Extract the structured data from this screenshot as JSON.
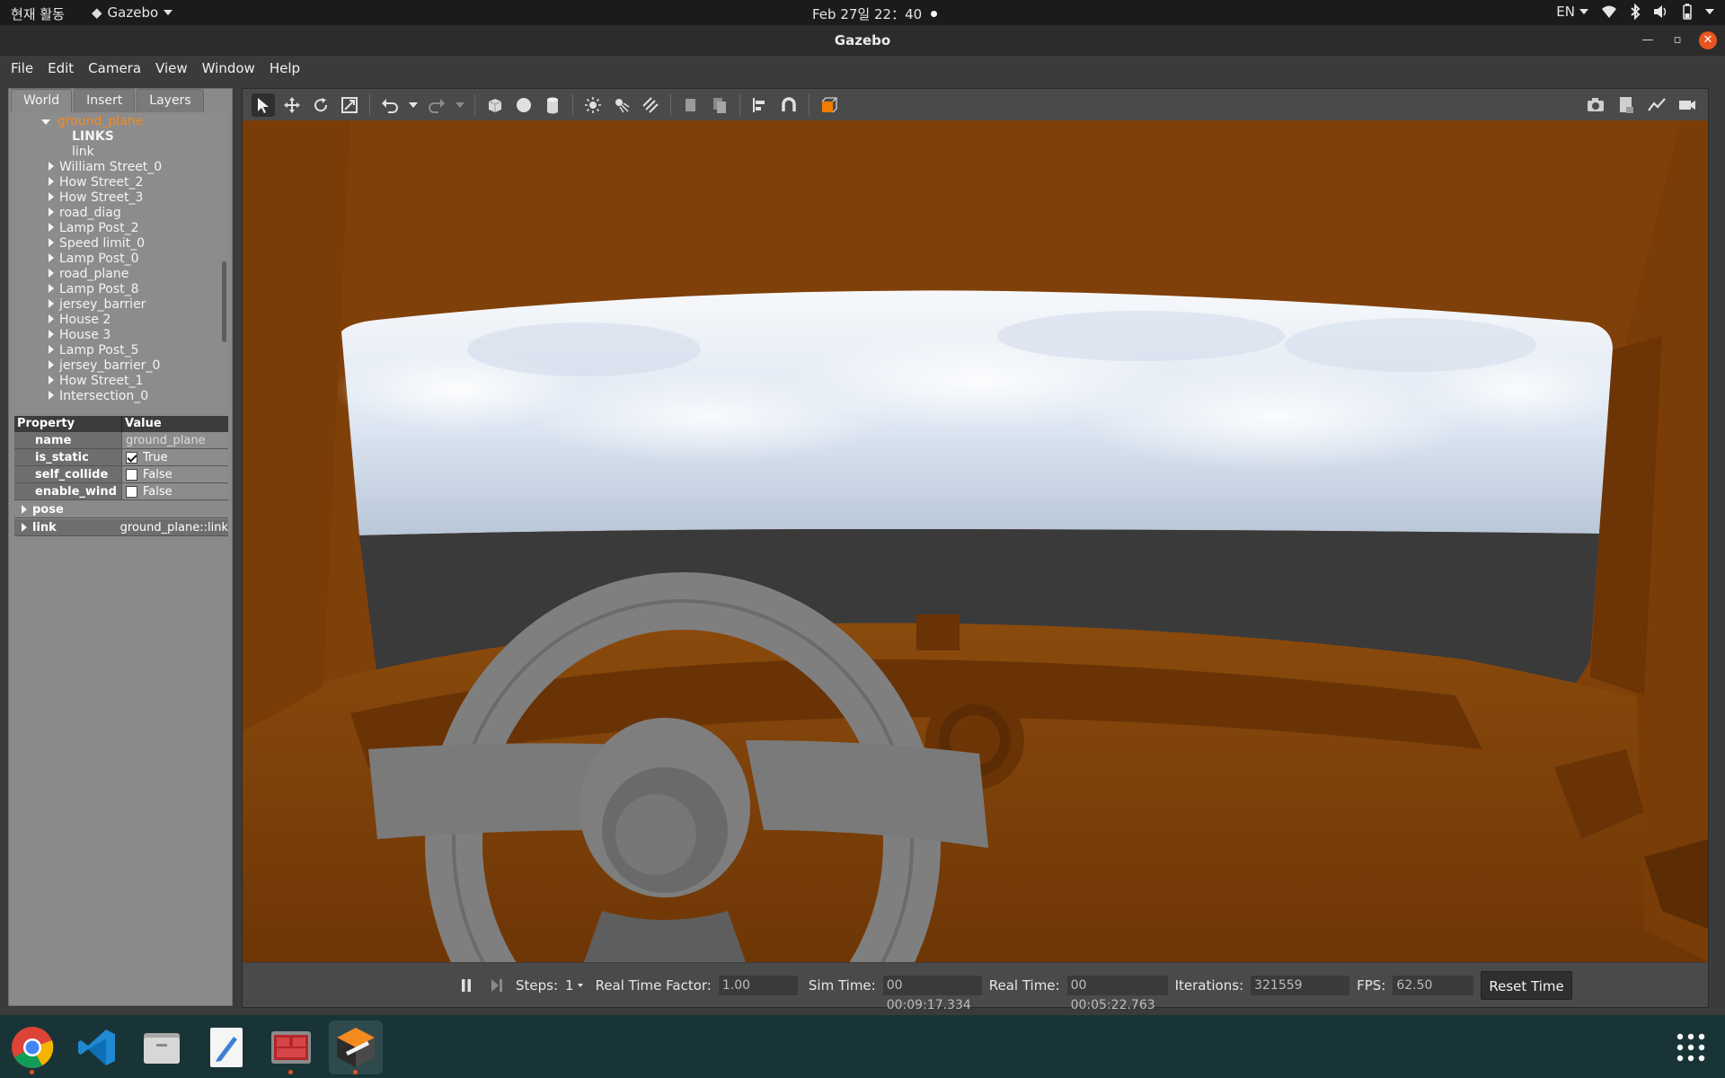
{
  "system_bar": {
    "activities": "현재 활동",
    "app_name": "Gazebo",
    "datetime": "Feb 27일  22：40",
    "language": "EN"
  },
  "window": {
    "title": "Gazebo"
  },
  "menu": [
    "File",
    "Edit",
    "Camera",
    "View",
    "Window",
    "Help"
  ],
  "left_panel": {
    "tabs": [
      "World",
      "Insert",
      "Layers"
    ],
    "active_tab": "World",
    "tree": {
      "selected": "ground_plane",
      "children_header": "LINKS",
      "child": "link",
      "items": [
        "William Street_0",
        "How Street_2",
        "How Street_3",
        "road_diag",
        "Lamp Post_2",
        "Speed limit_0",
        "Lamp Post_0",
        "road_plane",
        "Lamp Post_8",
        "jersey_barrier",
        "House 2",
        "House 3",
        "Lamp Post_5",
        "jersey_barrier_0",
        "How Street_1",
        "Intersection_0"
      ]
    },
    "properties": {
      "header_property": "Property",
      "header_value": "Value",
      "rows": [
        {
          "key": "name",
          "value": "ground_plane"
        },
        {
          "key": "is_static",
          "value": "True"
        },
        {
          "key": "self_collide",
          "value": "False"
        },
        {
          "key": "enable_wind",
          "value": "False"
        }
      ],
      "pose_label": "pose",
      "link_label": "link",
      "link_value": "ground_plane::link"
    }
  },
  "bottom_bar": {
    "steps_label": "Steps:",
    "steps_value": "1",
    "rtf_label": "Real Time Factor:",
    "rtf_value": "1.00",
    "sim_time_label": "Sim Time:",
    "sim_time_value": "00 00:09:17.334",
    "real_time_label": "Real Time:",
    "real_time_value": "00 00:05:22.763",
    "iterations_label": "Iterations:",
    "iterations_value": "321559",
    "fps_label": "FPS:",
    "fps_value": "62.50",
    "reset_label": "Reset Time"
  },
  "colors": {
    "accent_orange": "#f58a1f",
    "dashboard": "#7a3d08",
    "ubuntu_orange": "#e95420"
  },
  "dock_apps": [
    "chrome-icon",
    "vscode-icon",
    "files-icon",
    "text-editor-icon",
    "terminal-icon",
    "gazebo-icon",
    "app-grid-icon"
  ]
}
